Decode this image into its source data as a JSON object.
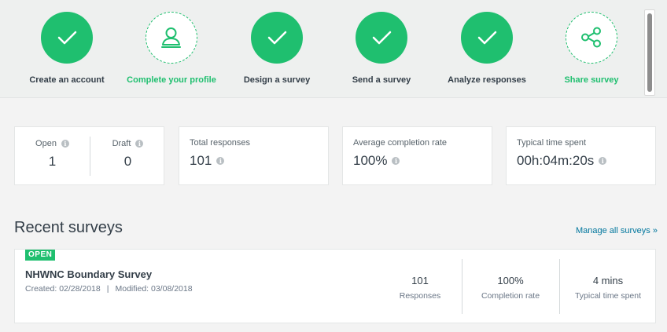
{
  "steps": [
    {
      "label": "Create an account",
      "status": "done",
      "icon": "check-icon"
    },
    {
      "label": "Complete your profile",
      "status": "active",
      "icon": "user-profile-icon"
    },
    {
      "label": "Design a survey",
      "status": "done",
      "icon": "check-icon"
    },
    {
      "label": "Send a survey",
      "status": "done",
      "icon": "check-icon"
    },
    {
      "label": "Analyze responses",
      "status": "done",
      "icon": "check-icon"
    },
    {
      "label": "Share survey",
      "status": "active",
      "icon": "share-icon"
    }
  ],
  "stats": {
    "open": {
      "label": "Open",
      "value": "1"
    },
    "draft": {
      "label": "Draft",
      "value": "0"
    },
    "total_responses": {
      "label": "Total responses",
      "value": "101"
    },
    "completion_rate": {
      "label": "Average completion rate",
      "value": "100%"
    },
    "time_spent": {
      "label": "Typical time spent",
      "value": "00h:04m:20s"
    }
  },
  "recent": {
    "title": "Recent surveys",
    "manage_link": "Manage all surveys »",
    "surveys": [
      {
        "badge": "OPEN",
        "name": "NHWNC Boundary Survey",
        "created": "Created: 02/28/2018",
        "separator": "|",
        "modified": "Modified: 03/08/2018",
        "responses_value": "101",
        "responses_label": "Responses",
        "completion_value": "100%",
        "completion_label": "Completion rate",
        "time_value": "4 mins",
        "time_label": "Typical time spent"
      }
    ]
  },
  "colors": {
    "accent": "#1fbf6f",
    "link": "#00769d",
    "text": "#333e48"
  }
}
